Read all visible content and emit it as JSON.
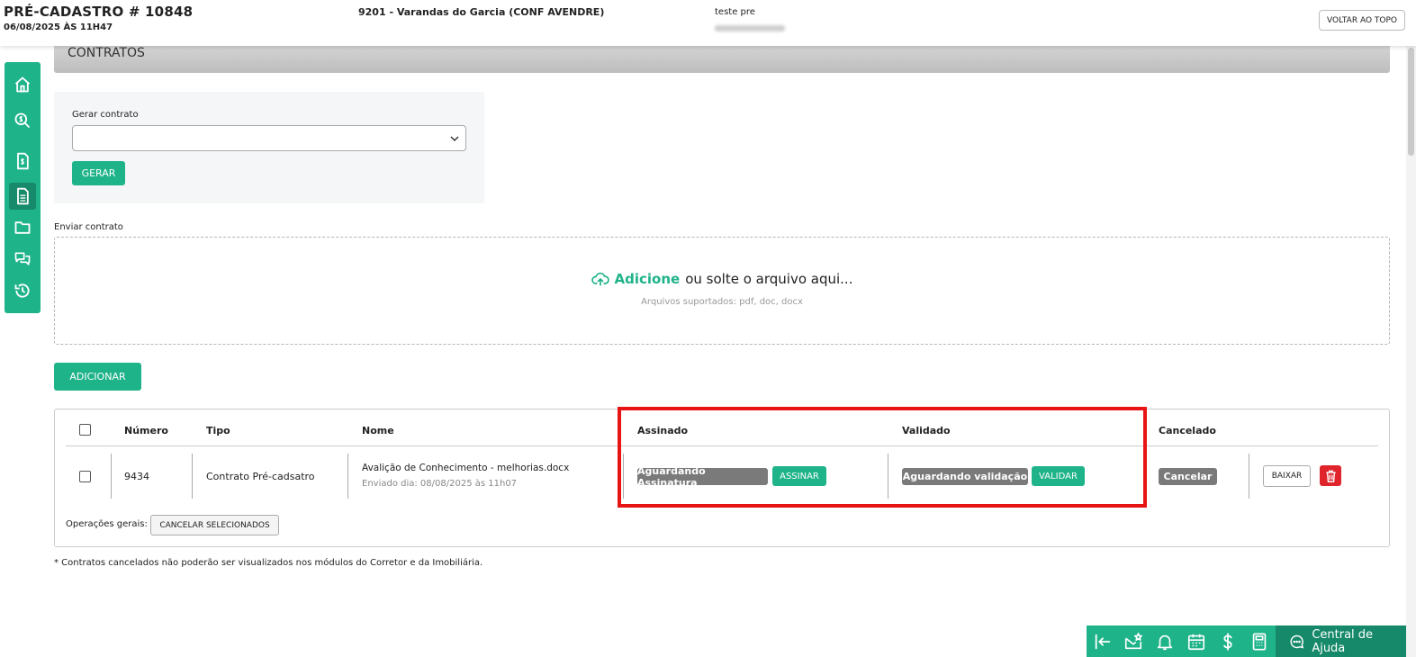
{
  "header": {
    "title": "PRÉ-CADASTRO # 10848",
    "date": "06/08/2025 ÀS 11H47",
    "empreendimento": "9201 - Varandas do Garcia (CONF AVENDRE)",
    "client_name": "teste pre",
    "back_to_top_label": "VOLTAR AO TOPO"
  },
  "sidebar": {
    "items": [
      {
        "icon": "home-icon",
        "active": false
      },
      {
        "icon": "money-search-icon",
        "active": false
      },
      {
        "icon": "invoice-icon",
        "active": false
      },
      {
        "icon": "document-icon",
        "active": true
      },
      {
        "icon": "folder-icon",
        "active": false
      },
      {
        "icon": "chat-icon",
        "active": false
      },
      {
        "icon": "history-icon",
        "active": false
      }
    ]
  },
  "section": {
    "title": "CONTRATOS"
  },
  "generate": {
    "label": "Gerar contrato",
    "select_value": "",
    "button_label": "GERAR"
  },
  "upload": {
    "label": "Enviar contrato",
    "add_text": "Adicione",
    "rest_text": "ou solte o arquivo aqui...",
    "supported": "Arquivos suportados: pdf, doc, docx"
  },
  "add_button_label": "ADICIONAR",
  "table": {
    "headers": {
      "numero": "Número",
      "tipo": "Tipo",
      "nome": "Nome",
      "assinado": "Assinado",
      "validado": "Validado",
      "cancelado": "Cancelado"
    },
    "rows": [
      {
        "numero": "9434",
        "tipo": "Contrato Pré-cadsatro",
        "nome": "Avalição de Conhecimento - melhorias.docx",
        "enviado": "Enviado dia: 08/08/2025 às 11h07",
        "assinado_status": "Aguardando Assinatura",
        "assinar_label": "ASSINAR",
        "validado_status": "Aguardando validação",
        "validar_label": "VALIDAR",
        "cancelar_label": "Cancelar",
        "baixar_label": "BAIXAR"
      }
    ],
    "ops_label": "Operações gerais:",
    "cancel_selected_label": "CANCELAR SELECIONADOS"
  },
  "footnote": "* Contratos cancelados não poderão ser visualizados nos módulos do Corretor e da Imobiliária.",
  "bottom_bar": {
    "icons": [
      "collapse-left-icon",
      "mail-star-icon",
      "bell-icon",
      "calendar-icon",
      "dollar-icon",
      "calculator-icon"
    ],
    "help_label": "Central de Ajuda"
  },
  "colors": {
    "accent": "#1fb38a",
    "accent_dark": "#16896a",
    "danger": "#e0242c",
    "highlight": "#e81414",
    "badge_gray": "#7a7a7a"
  }
}
